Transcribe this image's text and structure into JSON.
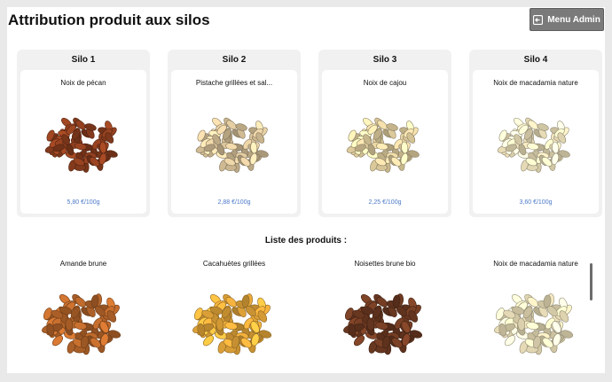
{
  "header": {
    "title": "Attribution produit aux silos",
    "admin_button_label": "Menu Admin"
  },
  "silos": [
    {
      "title": "Silo 1",
      "product": "Noix de pécan",
      "price": "5,80 €/100g",
      "icon": "pecan-nuts-image",
      "color": "#8a3d1e"
    },
    {
      "title": "Silo 2",
      "product": "Pistache grillées et sal...",
      "price": "2,88 €/100g",
      "icon": "pistachio-image",
      "color": "#d9c39a"
    },
    {
      "title": "Silo 3",
      "product": "Noix de cajou",
      "price": "2,25 €/100g",
      "icon": "cashew-image",
      "color": "#e6d3a3"
    },
    {
      "title": "Silo 4",
      "product": "Noix de macadamia nature",
      "price": "3,60 €/100g",
      "icon": "macadamia-image",
      "color": "#f2e6bf"
    }
  ],
  "product_list": {
    "heading": "Liste des produits :",
    "items": [
      {
        "name": "Amande brune",
        "icon": "almond-image",
        "color": "#b5652a"
      },
      {
        "name": "Cacahuètes grillées",
        "icon": "peanut-image",
        "color": "#e7a83a"
      },
      {
        "name": "Noisettes brune bio",
        "icon": "hazelnut-image",
        "color": "#6e3a22"
      },
      {
        "name": "Noix de macadamia nature",
        "icon": "macadamia-image",
        "color": "#f2e6bf"
      }
    ]
  },
  "colors": {
    "accent_price": "#4b79c8",
    "admin_button": "#7a7a7a"
  }
}
